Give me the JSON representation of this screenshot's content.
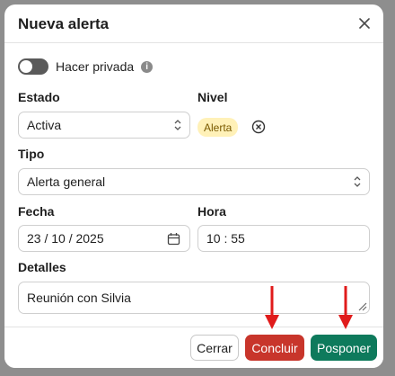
{
  "dialog": {
    "title": "Nueva alerta",
    "close_icon": "close-icon"
  },
  "private_toggle": {
    "label": "Hacer privada",
    "checked": false,
    "info_icon": "info-icon"
  },
  "estado": {
    "label": "Estado",
    "value": "Activa"
  },
  "nivel": {
    "label": "Nivel",
    "badge": "Alerta",
    "badge_color": "#fff1b8"
  },
  "tipo": {
    "label": "Tipo",
    "value": "Alerta general"
  },
  "fecha": {
    "label": "Fecha",
    "value": "23 / 10 / 2025"
  },
  "hora": {
    "label": "Hora",
    "value": "10 : 55"
  },
  "detalles": {
    "label": "Detalles",
    "value": "Reunión con Silvia"
  },
  "footer": {
    "cancel_label": "Cerrar",
    "conclude_label": "Concluir",
    "postpone_label": "Posponer",
    "conclude_color": "#c8352b",
    "postpone_color": "#0e7a5c"
  },
  "annotations": {
    "arrow_color": "#e01b1b"
  }
}
